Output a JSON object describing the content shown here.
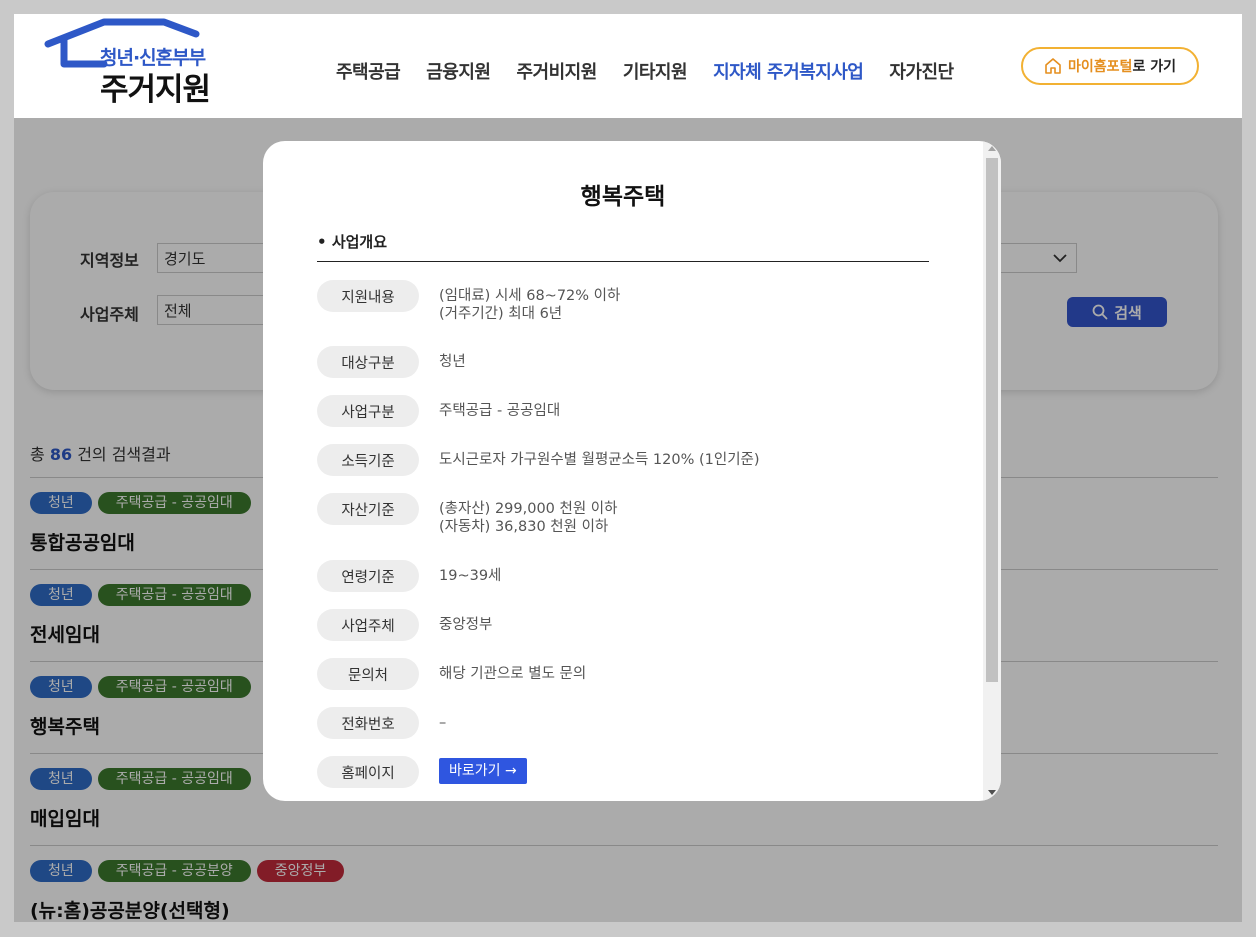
{
  "header": {
    "logo_sub": "청년·신혼부부",
    "logo_main": "주거지원",
    "nav": [
      "주택공급",
      "금융지원",
      "주거비지원",
      "기타지원",
      "지자체 주거복지사업",
      "자가진단"
    ],
    "portal_highlight": "마이홈포털",
    "portal_suffix": "로 가기"
  },
  "search": {
    "region_label": "지역정보",
    "region_value": "경기도",
    "operator_label": "사업주체",
    "operator_value": "전체",
    "button_label": "검색"
  },
  "results": {
    "prefix": "총",
    "count": "86",
    "suffix": "건의 검색결과",
    "items": [
      {
        "tags": [
          "청년",
          "주택공급 - 공공임대"
        ],
        "title": "통합공공임대"
      },
      {
        "tags": [
          "청년",
          "주택공급 - 공공임대"
        ],
        "title": "전세임대"
      },
      {
        "tags": [
          "청년",
          "주택공급 - 공공임대"
        ],
        "title": "행복주택"
      },
      {
        "tags": [
          "청년",
          "주택공급 - 공공임대"
        ],
        "title": "매입임대"
      },
      {
        "tags": [
          "청년",
          "주택공급 - 공공분양",
          "중앙정부"
        ],
        "title": "(뉴:홈)공공분양(선택형)"
      }
    ]
  },
  "modal": {
    "title": "행복주택",
    "section": "사업개요",
    "rows": [
      {
        "label": "지원내용",
        "lines": [
          "(임대료) 시세 68~72% 이하",
          "(거주기간) 최대 6년"
        ]
      },
      {
        "label": "대상구분",
        "lines": [
          "청년"
        ]
      },
      {
        "label": "사업구분",
        "lines": [
          "주택공급 - 공공임대"
        ]
      },
      {
        "label": "소득기준",
        "lines": [
          "도시근로자 가구원수별 월평균소득 120% (1인기준)"
        ]
      },
      {
        "label": "자산기준",
        "lines": [
          "(총자산) 299,000 천원 이하",
          "(자동차) 36,830 천원 이하"
        ]
      },
      {
        "label": "연령기준",
        "lines": [
          "19~39세"
        ]
      },
      {
        "label": "사업주체",
        "lines": [
          "중앙정부"
        ]
      },
      {
        "label": "문의처",
        "lines": [
          "해당 기관으로 별도 문의"
        ]
      },
      {
        "label": "전화번호",
        "lines": [
          "–"
        ]
      }
    ],
    "homepage_label": "홈페이지",
    "homepage_link": "바로가기 →"
  },
  "colors": {
    "brand_blue": "#2e58c7",
    "portal_orange": "#f2b133",
    "tag_blue": "#2f6cc6",
    "tag_green": "#3c7a2e",
    "tag_red": "#c22a3b",
    "link_blue": "#2f56e0"
  }
}
